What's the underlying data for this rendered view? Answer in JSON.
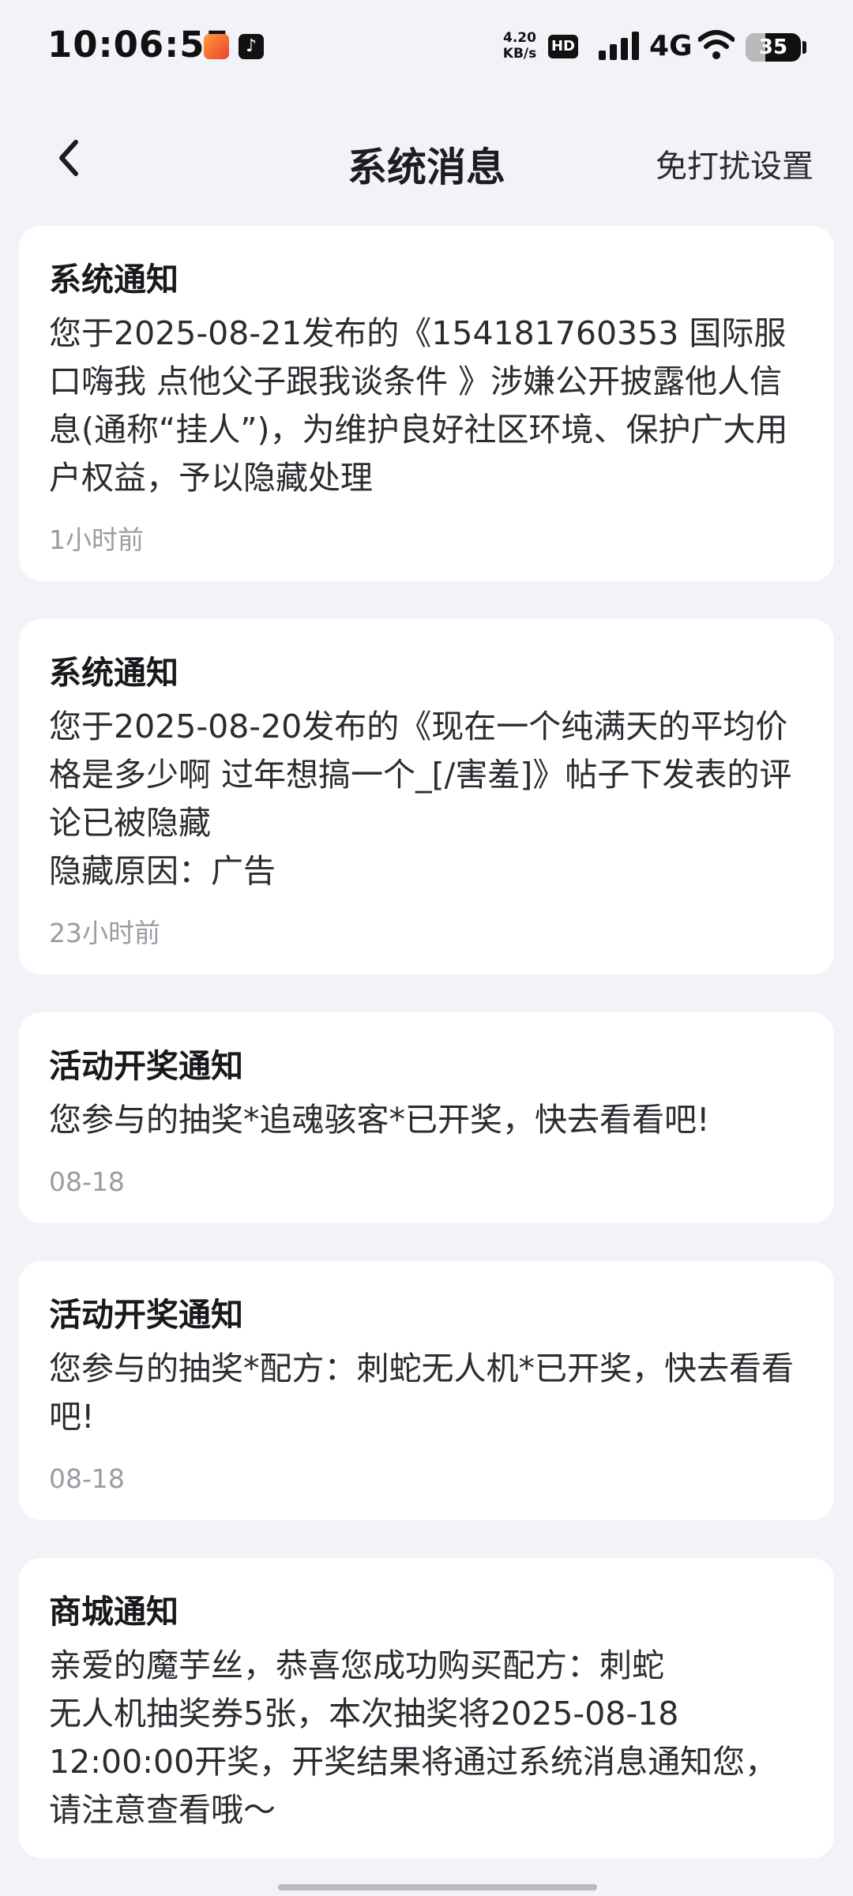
{
  "status_bar": {
    "time": "10:06:55",
    "douyin_glyph": "♪",
    "net_speed_value": "4.20",
    "net_speed_unit": "KB/s",
    "hd_label": "HD",
    "network_type": "4G",
    "battery_level": "35",
    "battery_fraction": 0.35
  },
  "header": {
    "title": "系统消息",
    "right_action": "免打扰设置",
    "back_icon": "chevron-left-icon"
  },
  "messages": [
    {
      "title": "系统通知",
      "body": "您于2025-08-21发布的《154181760353 国际服口嗨我 点他父子跟我谈条件 》涉嫌公开披露他人信息(通称“挂人”)，为维护良好社区环境、保护广大用户权益，予以隐藏处理",
      "time": "1小时前"
    },
    {
      "title": "系统通知",
      "body": "您于2025-08-20发布的《现在一个纯满天的平均价格是多少啊 过年想搞一个_[/害羞]》帖子下发表的评论已被隐藏\n隐藏原因：广告",
      "time": "23小时前"
    },
    {
      "title": "活动开奖通知",
      "body": "您参与的抽奖*追魂骇客*已开奖，快去看看吧!",
      "time": "08-18"
    },
    {
      "title": "活动开奖通知",
      "body": "您参与的抽奖*配方：刺蛇无人机*已开奖，快去看看吧!",
      "time": "08-18"
    },
    {
      "title": "商城通知",
      "body": "亲爱的魔芋丝，恭喜您成功购买配方：刺蛇\n无人机抽奖券5张，本次抽奖将2025-08-18\n12:00:00开奖，开奖结果将通过系统消息通知您，请注意查看哦～",
      "time": ""
    }
  ]
}
